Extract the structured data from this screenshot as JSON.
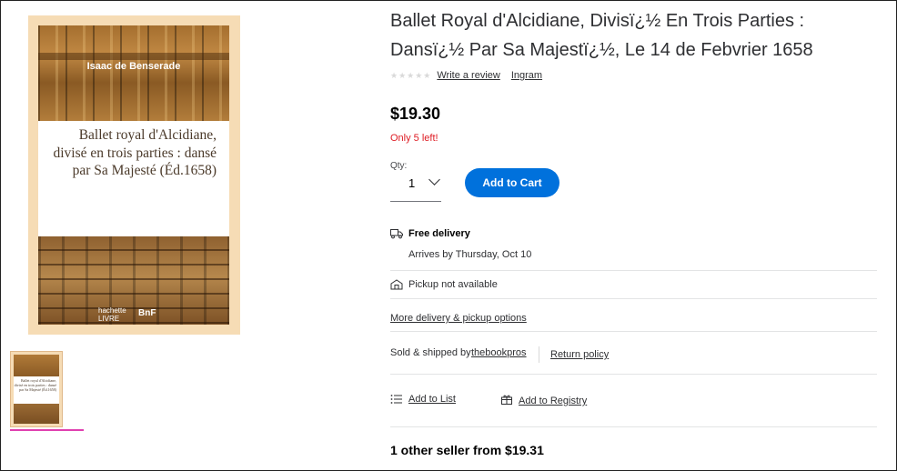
{
  "cover": {
    "author": "Isaac de Benserade",
    "title_lines": [
      "Ballet royal d'Alcidiane,",
      "divisé en trois parties : dansé",
      "par Sa Majesté (Éd.1658)"
    ],
    "publisher": "hachette\nLIVRE",
    "bnf": "BnF"
  },
  "product": {
    "title": "Ballet Royal d'Alcidiane, Divisï¿½ En Trois Parties : Dansï¿½ Par Sa Majestï¿½, Le 14 de Febvrier 1658",
    "stars": "★★★★★",
    "write_review": "Write a review",
    "brand": "Ingram",
    "price": "$19.30",
    "stock": "Only 5 left!",
    "qty_label": "Qty:",
    "qty_value": "1",
    "add_to_cart": "Add to Cart"
  },
  "fulfillment": {
    "delivery_title": "Free delivery",
    "delivery_date": "Arrives by Thursday, Oct 10",
    "pickup": "Pickup not available",
    "more_options": "More delivery & pickup options",
    "sold_by_prefix": "Sold & shipped by",
    "seller": "thebookpros",
    "return_policy": "Return policy",
    "add_to_list": "Add to List",
    "add_to_registry": "Add to Registry"
  },
  "other_sellers": "1 other seller from $19.31",
  "icons": [
    "truck-icon",
    "store-icon",
    "list-icon",
    "gift-icon",
    "chevron-down-icon"
  ],
  "colors": {
    "accent": "#0071dc",
    "stock_warning": "#de1c24",
    "thumb_selected": "#e040b0"
  }
}
